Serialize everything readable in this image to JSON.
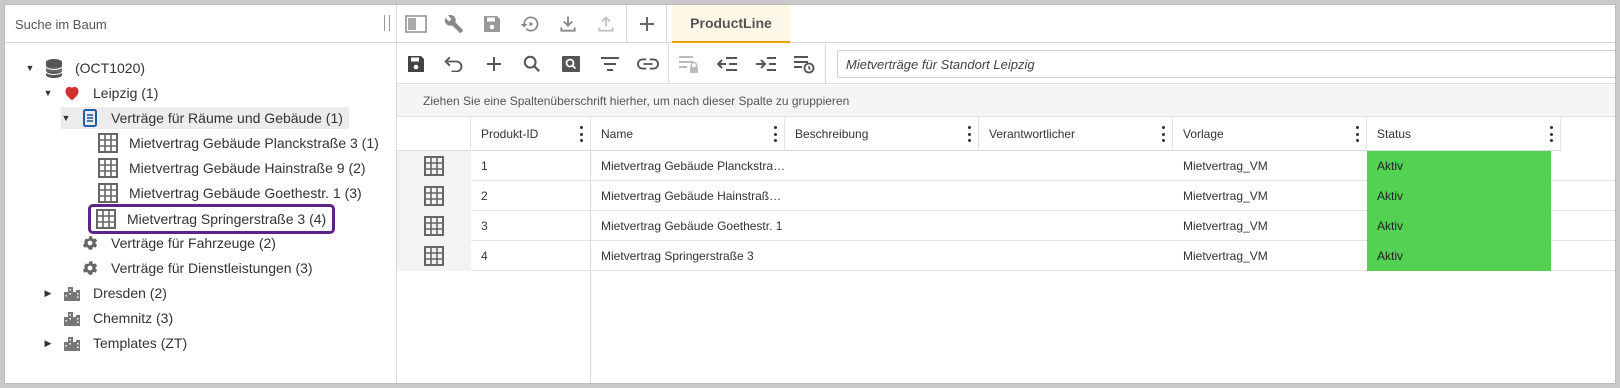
{
  "search": {
    "placeholder": "Suche im Baum"
  },
  "tree": {
    "root": {
      "label": "(OCT1020)"
    },
    "leipzig": {
      "label": "Leipzig (1)"
    },
    "vertraege_raeume": {
      "label": "Verträge für Räume und Gebäude (1)"
    },
    "items": [
      {
        "label": "Mietvertrag Gebäude Planckstraße 3 (1)"
      },
      {
        "label": "Mietvertrag Gebäude Hainstraße 9 (2)"
      },
      {
        "label": "Mietvertrag Gebäude Goethestr. 1 (3)"
      },
      {
        "label": "Mietvertrag Springerstraße 3 (4)"
      }
    ],
    "fahrzeuge": {
      "label": "Verträge für Fahrzeuge (2)"
    },
    "dienstleistungen": {
      "label": "Verträge für Dienstleistungen (3)"
    },
    "dresden": {
      "label": "Dresden (2)"
    },
    "chemnitz": {
      "label": "Chemnitz (3)"
    },
    "templates": {
      "label": "Templates (ZT)"
    }
  },
  "tab": {
    "label": "ProductLine"
  },
  "view": {
    "value": "Mietverträge für Standort Leipzig"
  },
  "groupbar": {
    "text": "Ziehen Sie eine Spaltenüberschrift hierher, um nach dieser Spalte zu gruppieren"
  },
  "columns": [
    "Produkt-ID",
    "Name",
    "Beschreibung",
    "Verantwortlicher",
    "Vorlage",
    "Status"
  ],
  "rows": [
    {
      "id": "1",
      "name": "Mietvertrag Gebäude Planckstra…",
      "beschreibung": "",
      "verantwortlicher": "",
      "vorlage": "Mietvertrag_VM",
      "status": "Aktiv"
    },
    {
      "id": "2",
      "name": "Mietvertrag Gebäude Hainstraß…",
      "beschreibung": "",
      "verantwortlicher": "",
      "vorlage": "Mietvertrag_VM",
      "status": "Aktiv"
    },
    {
      "id": "3",
      "name": "Mietvertrag Gebäude Goethestr. 1",
      "beschreibung": "",
      "verantwortlicher": "",
      "vorlage": "Mietvertrag_VM",
      "status": "Aktiv"
    },
    {
      "id": "4",
      "name": "Mietvertrag Springerstraße 3",
      "beschreibung": "",
      "verantwortlicher": "",
      "vorlage": "Mietvertrag_VM",
      "status": "Aktiv"
    }
  ],
  "colors": {
    "accent": "#e3a400",
    "status_active": "#52d152",
    "selection_outline": "#5b2485",
    "heart": "#d32f2f",
    "doc_blue": "#1f5fa8"
  }
}
